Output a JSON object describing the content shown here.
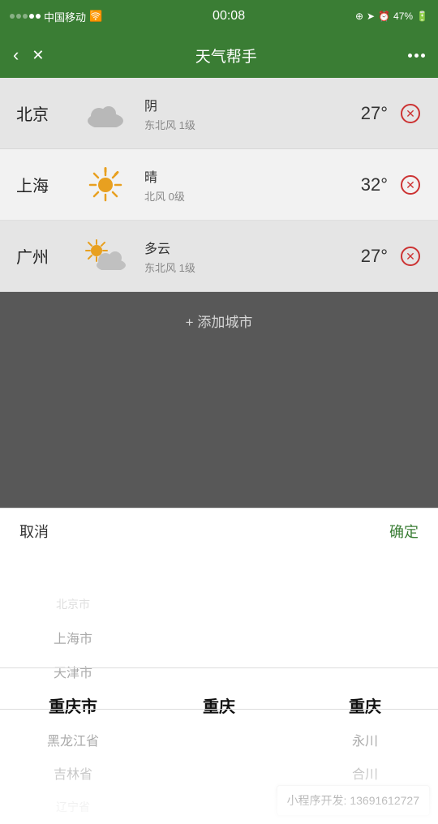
{
  "statusBar": {
    "carrier": "中国移动",
    "time": "00:08",
    "battery": "47%",
    "icons": [
      "location",
      "alarm",
      "battery"
    ]
  },
  "navBar": {
    "title": "天气帮手",
    "backLabel": "‹",
    "closeLabel": "✕"
  },
  "weatherList": {
    "items": [
      {
        "city": "北京",
        "iconType": "cloud",
        "condition": "阴",
        "wind": "东北风 1级",
        "temp": "27°"
      },
      {
        "city": "上海",
        "iconType": "sun",
        "condition": "晴",
        "wind": "北风 0级",
        "temp": "32°"
      },
      {
        "city": "广州",
        "iconType": "partly-cloudy",
        "condition": "多云",
        "wind": "东北风 1级",
        "temp": "27°"
      }
    ],
    "addCityLabel": "+ 添加城市"
  },
  "actionBar": {
    "cancelLabel": "取消",
    "confirmLabel": "确定"
  },
  "picker": {
    "columns": [
      {
        "items": [
          "北京市",
          "上海市",
          "天津市",
          "重庆市",
          "黑龙江省",
          "吉林省",
          "辽宁省"
        ],
        "selectedIndex": 3
      },
      {
        "items": [
          "",
          "",
          "",
          "重庆",
          "",
          "",
          ""
        ],
        "selectedIndex": 3
      },
      {
        "items": [
          "",
          "",
          "",
          "重庆",
          "永川",
          "合川",
          ""
        ],
        "selectedIndex": 3
      }
    ]
  },
  "miniProgram": {
    "label": "小程序开发: 13691612727"
  }
}
